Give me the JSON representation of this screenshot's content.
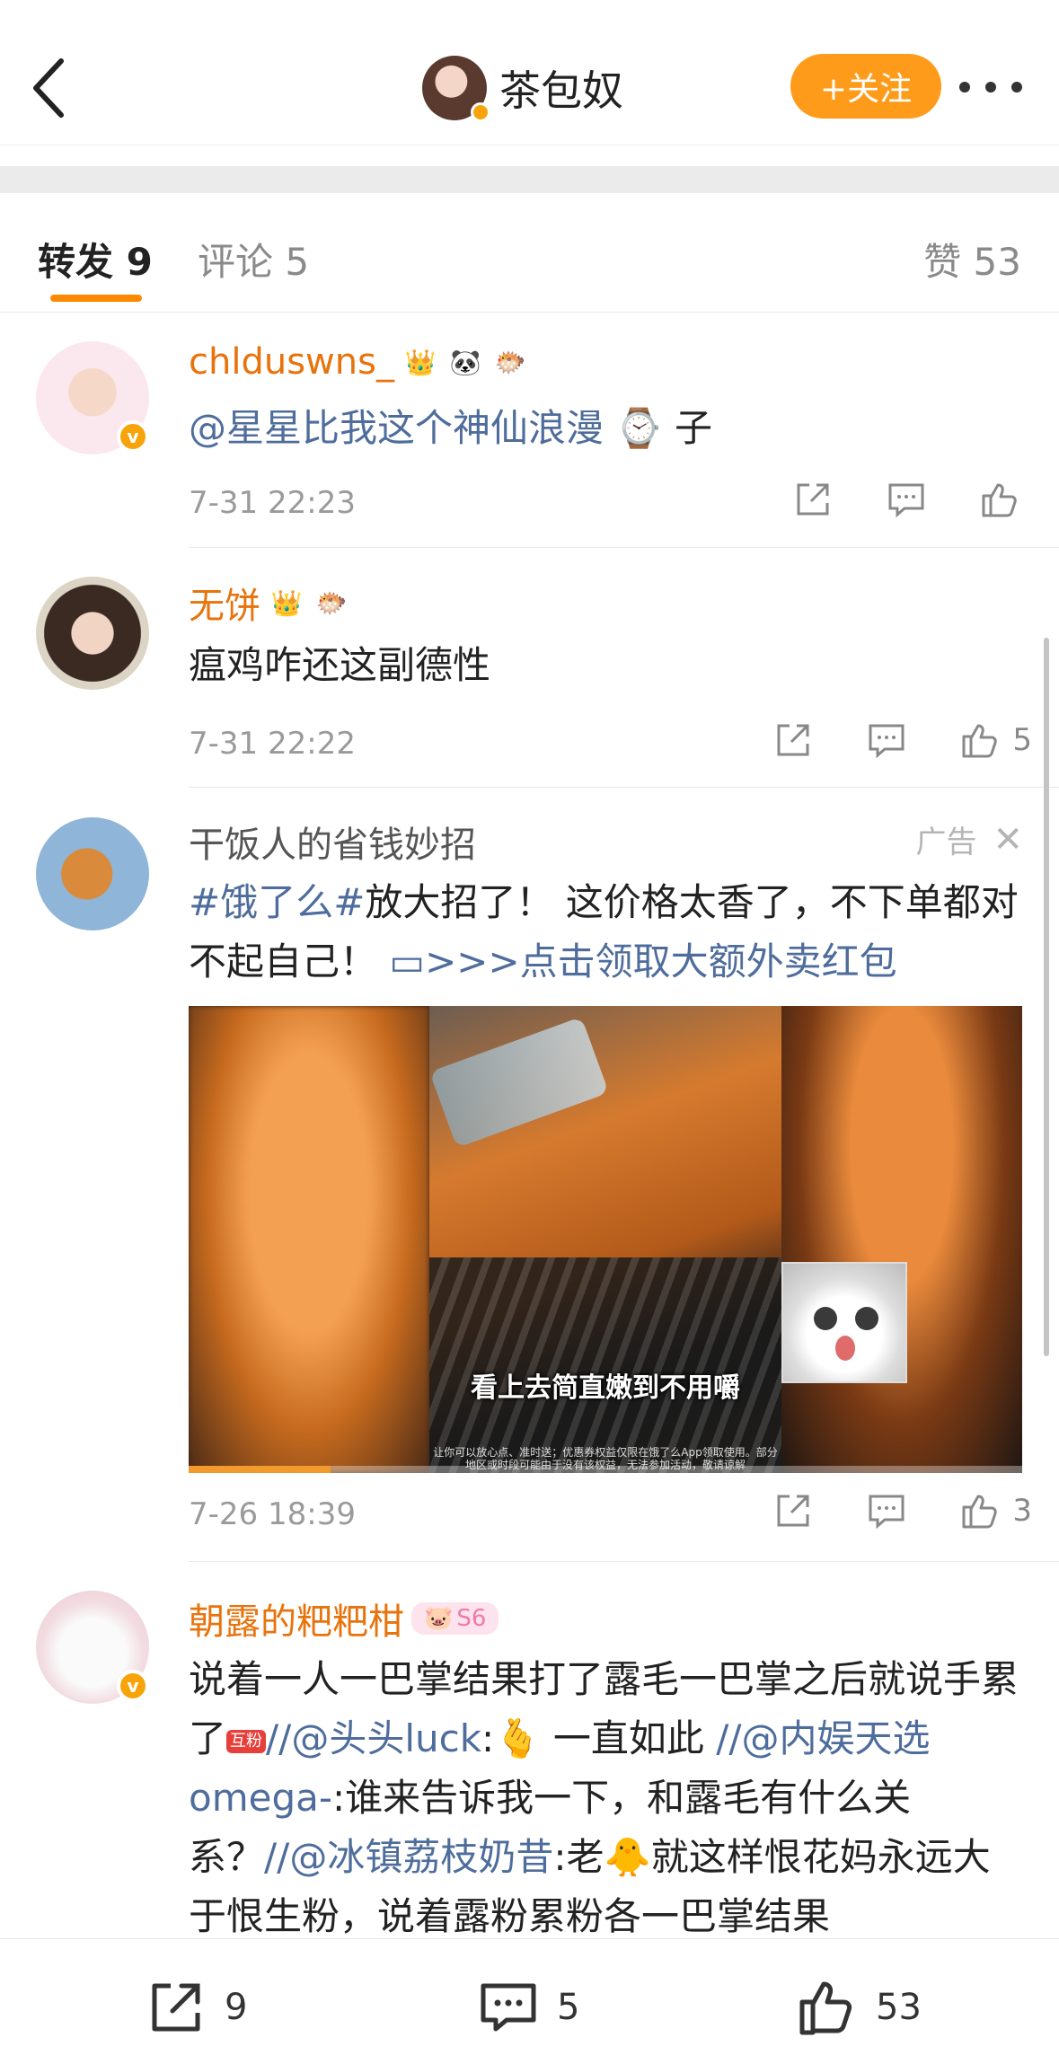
{
  "header": {
    "username": "茶包奴",
    "follow_label": "+关注"
  },
  "tabs": {
    "repost": "转发 9",
    "comment": "评论 5",
    "likes": "赞 53"
  },
  "feed": [
    {
      "user": "chlduswns_",
      "text_link": "@星星比我这个神仙浪漫",
      "text_tail": "子",
      "time": "7-31 22:23",
      "likes": ""
    },
    {
      "user": "无饼",
      "text": "瘟鸡咋还这副德性",
      "time": "7-31 22:22",
      "likes": "5"
    },
    {
      "user": "干饭人的省钱妙招",
      "ad_label": "广告",
      "text_hashtag": "#饿了么#",
      "text_body": "放大招了！ 这价格太香了，不下单都对不起自己！",
      "text_link": ">>>点击领取大额外卖红包",
      "video_subtitle": "看上去简直嫩到不用嚼",
      "video_disclaimer": "让你可以放心点、准时送；优惠券权益仅限在饿了么App领取使用。部分地区或时段可能由于没有该权益，无法参加活动，敬请谅解",
      "video_progress": 0.17,
      "time": "7-26 18:39",
      "likes": "3"
    },
    {
      "user": "朝露的粑粑柑",
      "fan_badge": "S6",
      "text_a": "说着一人一巴掌结果打了露毛一巴掌之后就说手累了",
      "fan_tag": "互粉",
      "mention1": "//@头头luck",
      "text_b": ":",
      "text_c": " 一直如此 ",
      "mention2": "//@内娱天选omega-",
      "text_d": ":谁来告诉我一下，和露毛有什么关系？",
      "mention3": "//@冰镇荔枝奶昔",
      "text_e": ":老",
      "text_f": "就这样恨花妈永远大于恨生粉，说着露粉累粉各一巴掌结果"
    }
  ],
  "bottom_bar": {
    "repost_count": "9",
    "comment_count": "5",
    "like_count": "53"
  },
  "colors": {
    "accent": "#ff9b1a",
    "username": "#e8730c",
    "link": "#4f6d9c"
  }
}
